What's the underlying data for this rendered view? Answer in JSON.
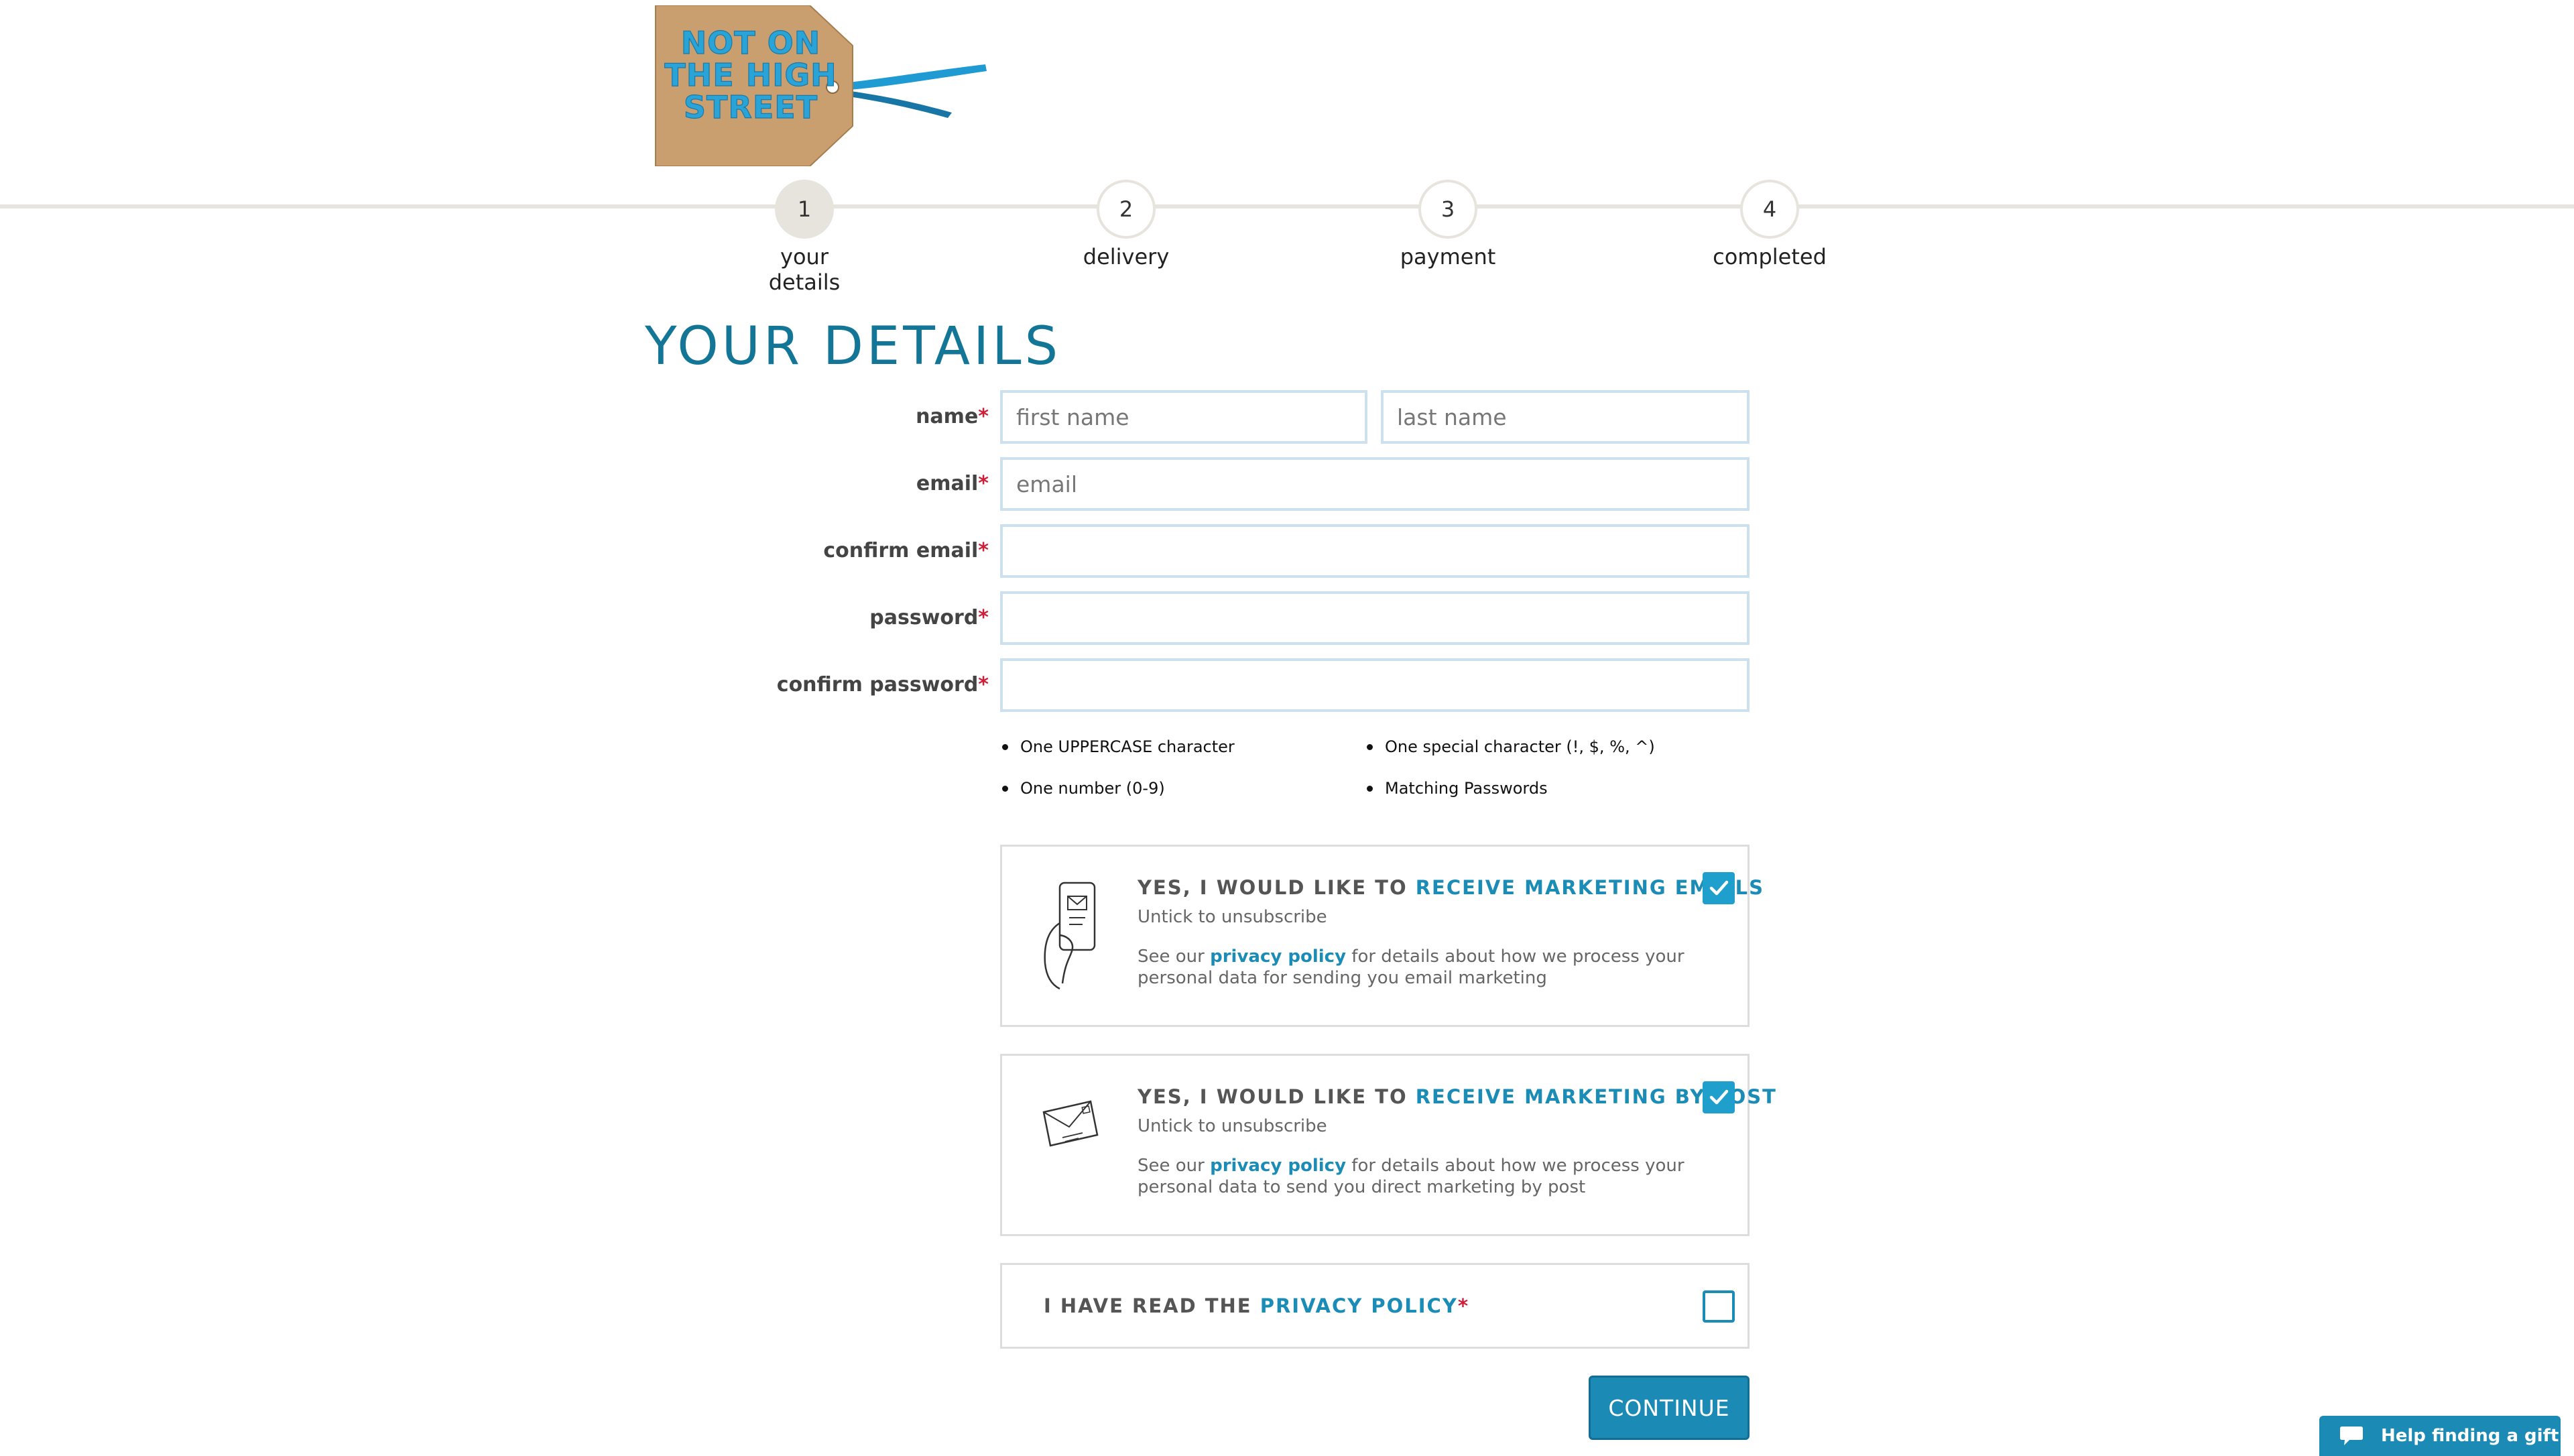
{
  "brand": {
    "logo_lines": [
      "NOT ON",
      "THE HIGH",
      "STREET"
    ],
    "tag_color": "#c99f6f",
    "ribbon_color": "#1f9ad3"
  },
  "steps": [
    {
      "number": "1",
      "label": "your details",
      "active": true
    },
    {
      "number": "2",
      "label": "delivery",
      "active": false
    },
    {
      "number": "3",
      "label": "payment",
      "active": false
    },
    {
      "number": "4",
      "label": "completed",
      "active": false
    }
  ],
  "page_title": "YOUR DETAILS",
  "form": {
    "required_marker": "*",
    "name_label": "name",
    "first_name_placeholder": "first name",
    "first_name_value": "",
    "last_name_placeholder": "last name",
    "last_name_value": "",
    "email_label": "email",
    "email_placeholder": "email",
    "email_value": "",
    "confirm_email_label": "confirm email",
    "confirm_email_value": "",
    "password_label": "password",
    "password_value": "",
    "confirm_password_label": "confirm password",
    "confirm_password_value": ""
  },
  "password_rules": [
    "One UPPERCASE character",
    "One special character (!, $, %, ^)",
    "One number (0-9)",
    "Matching Passwords"
  ],
  "consents": [
    {
      "heading_prefix": "YES, I WOULD LIKE TO ",
      "heading_highlight": "RECEIVE MARKETING EMAILS",
      "sub": "Untick to unsubscribe",
      "desc_prefix": "See our ",
      "desc_link": "privacy policy",
      "desc_suffix": " for details about how we process your personal data for sending you email marketing",
      "checked": true,
      "icon": "phone-email-icon"
    },
    {
      "heading_prefix": "YES, I WOULD LIKE TO ",
      "heading_highlight": "RECEIVE MARKETING BY POST",
      "sub": "Untick to unsubscribe",
      "desc_prefix": "See our ",
      "desc_link": "privacy policy",
      "desc_suffix": " for details about how we process your personal data to send you direct marketing by post",
      "checked": true,
      "icon": "envelope-icon"
    }
  ],
  "privacy": {
    "prefix": "I HAVE READ THE ",
    "link": "PRIVACY POLICY",
    "required_marker": "*",
    "checked": false
  },
  "continue_label": "CONTINUE",
  "help_label": "Help finding a gift",
  "colors": {
    "accent": "#1b8cb5",
    "title": "#147697",
    "required": "#cc1f3a",
    "step_track": "#e6e4dc"
  }
}
